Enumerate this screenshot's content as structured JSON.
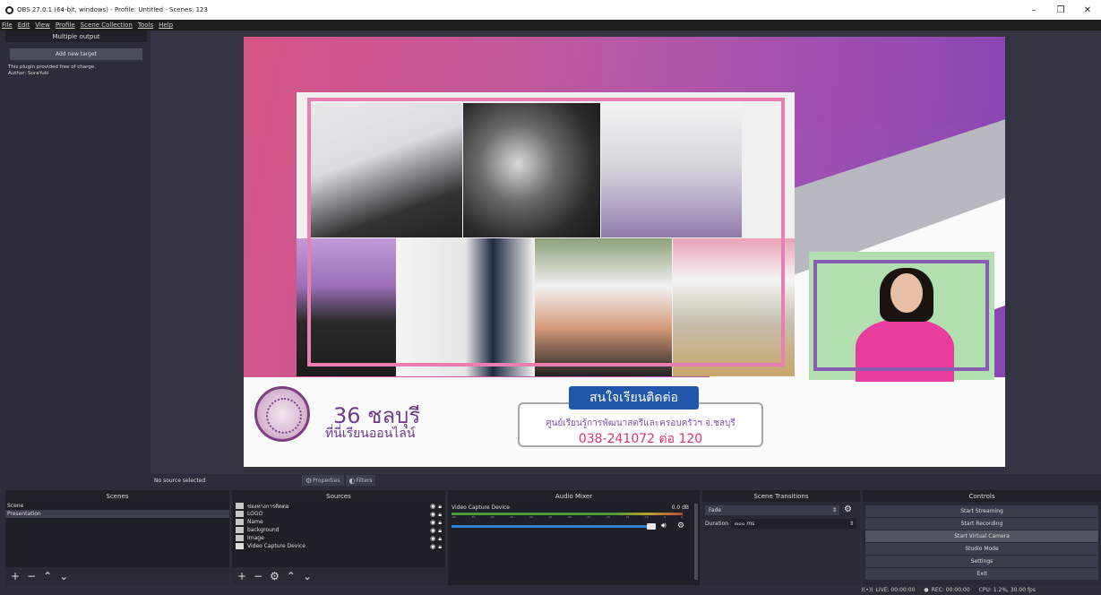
{
  "window": {
    "title": "OBS 27.0.1 (64-bit, windows) - Profile: Untitled - Scenes: 123",
    "minimize": "–",
    "maximize": "❐",
    "close": "✕"
  },
  "menu": [
    "File",
    "Edit",
    "View",
    "Profile",
    "Scene Collection",
    "Tools",
    "Help"
  ],
  "multiple_output": {
    "title": "Multiple output",
    "add_button": "Add new target",
    "plugin_line1": "This plugin provided free of charge.",
    "plugin_line2": "Author: SoraYuki"
  },
  "preview": {
    "title_number": "36 ชลบุรี",
    "title_sub": "ที่นี่เรียนออนไลน์",
    "contact_badge": "สนใจเรียนติดต่อ",
    "contact_org": "ศูนย์เรียนรู้การพัฒนาสตรีและครอบครัวฯ จ.ชลบุรี",
    "contact_phone": "038-241072 ต่อ 120"
  },
  "source_toolbar": {
    "status": "No source selected",
    "properties": "Properties",
    "filters": "Filters"
  },
  "scenes": {
    "title": "Scenes",
    "items": [
      "Scene",
      "Presentation"
    ],
    "selected": "Presentation"
  },
  "sources": {
    "title": "Sources",
    "items": [
      "ช่องทางการติดต่อ",
      "LOGO",
      "Name",
      "background",
      "Image",
      "Video Capture Device"
    ]
  },
  "audio_mixer": {
    "title": "Audio Mixer",
    "channel_name": "Video Capture Device",
    "channel_db": "0.0 dB",
    "scale": [
      "-60",
      "-55",
      "-50",
      "-45",
      "-40",
      "-35",
      "-30",
      "-25",
      "-20",
      "-15",
      "-10",
      "-5",
      "0"
    ]
  },
  "scene_transitions": {
    "title": "Scene Transitions",
    "transition": "Fade",
    "duration_label": "Duration",
    "duration_value": "๓๐๐ ms"
  },
  "controls": {
    "title": "Controls",
    "buttons": [
      "Start Streaming",
      "Start Recording",
      "Start Virtual Camera",
      "Studio Mode",
      "Settings",
      "Exit"
    ]
  },
  "status": {
    "live": "LIVE: 00:00:00",
    "rec": "REC: 00:00:00",
    "cpu": "CPU: 1.2%, 30.00 fps"
  },
  "colors": {
    "accent_pink": "#e87fb0",
    "accent_purple": "#8a5db4",
    "badge_blue": "#2157a8",
    "phone_red": "#e0336b"
  }
}
